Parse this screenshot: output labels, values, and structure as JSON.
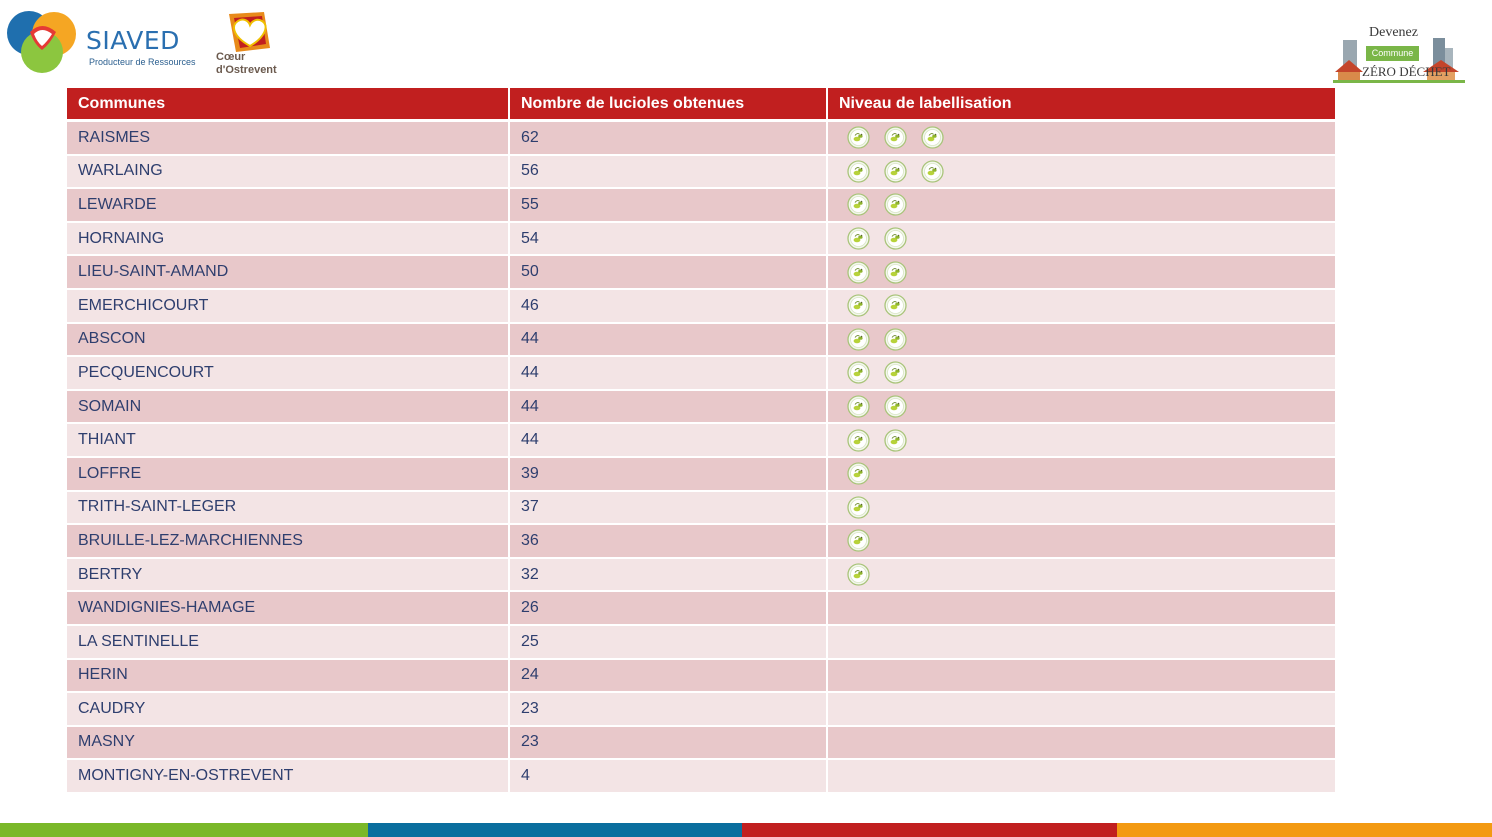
{
  "header": {
    "siaved_name": "SIAVED",
    "siaved_tagline": "Producteur de Ressources",
    "coeur_name_1": "Cœur",
    "coeur_name_2": "d'Ostrevent",
    "zd_line1": "Devenez",
    "zd_line2": "Commune",
    "zd_line3": "ZÉRO DÉCHET"
  },
  "table": {
    "headers": [
      "Communes",
      "Nombre de lucioles obtenues",
      "Niveau de labellisation"
    ],
    "rows": [
      {
        "commune": "RAISMES",
        "lucioles": "62",
        "level": 3
      },
      {
        "commune": "WARLAING",
        "lucioles": "56",
        "level": 3
      },
      {
        "commune": "LEWARDE",
        "lucioles": "55",
        "level": 2
      },
      {
        "commune": "HORNAING",
        "lucioles": "54",
        "level": 2
      },
      {
        "commune": "LIEU-SAINT-AMAND",
        "lucioles": "50",
        "level": 2
      },
      {
        "commune": "EMERCHICOURT",
        "lucioles": "46",
        "level": 2
      },
      {
        "commune": "ABSCON",
        "lucioles": "44",
        "level": 2
      },
      {
        "commune": "PECQUENCOURT",
        "lucioles": "44",
        "level": 2
      },
      {
        "commune": "SOMAIN",
        "lucioles": "44",
        "level": 2
      },
      {
        "commune": "THIANT",
        "lucioles": "44",
        "level": 2
      },
      {
        "commune": "LOFFRE",
        "lucioles": "39",
        "level": 1
      },
      {
        "commune": "TRITH-SAINT-LEGER",
        "lucioles": "37",
        "level": 1
      },
      {
        "commune": "BRUILLE-LEZ-MARCHIENNES",
        "lucioles": "36",
        "level": 1
      },
      {
        "commune": "BERTRY",
        "lucioles": "32",
        "level": 1
      },
      {
        "commune": "WANDIGNIES-HAMAGE",
        "lucioles": "26",
        "level": 0
      },
      {
        "commune": "LA SENTINELLE",
        "lucioles": "25",
        "level": 0
      },
      {
        "commune": "HERIN",
        "lucioles": "24",
        "level": 0
      },
      {
        "commune": "CAUDRY",
        "lucioles": "23",
        "level": 0
      },
      {
        "commune": "MASNY",
        "lucioles": "23",
        "level": 0
      },
      {
        "commune": "MONTIGNY-EN-OSTREVENT",
        "lucioles": "4",
        "level": 0
      }
    ],
    "badge_icon": "firefly-badge-icon"
  },
  "colors": {
    "header_bg": "#c11f1f",
    "row_odd": "#e8c8ca",
    "row_even": "#f3e4e5",
    "text": "#2e3e6e",
    "footer": [
      "#7ab829",
      "#0a6e9e",
      "#c11f1f",
      "#f39a12"
    ]
  }
}
